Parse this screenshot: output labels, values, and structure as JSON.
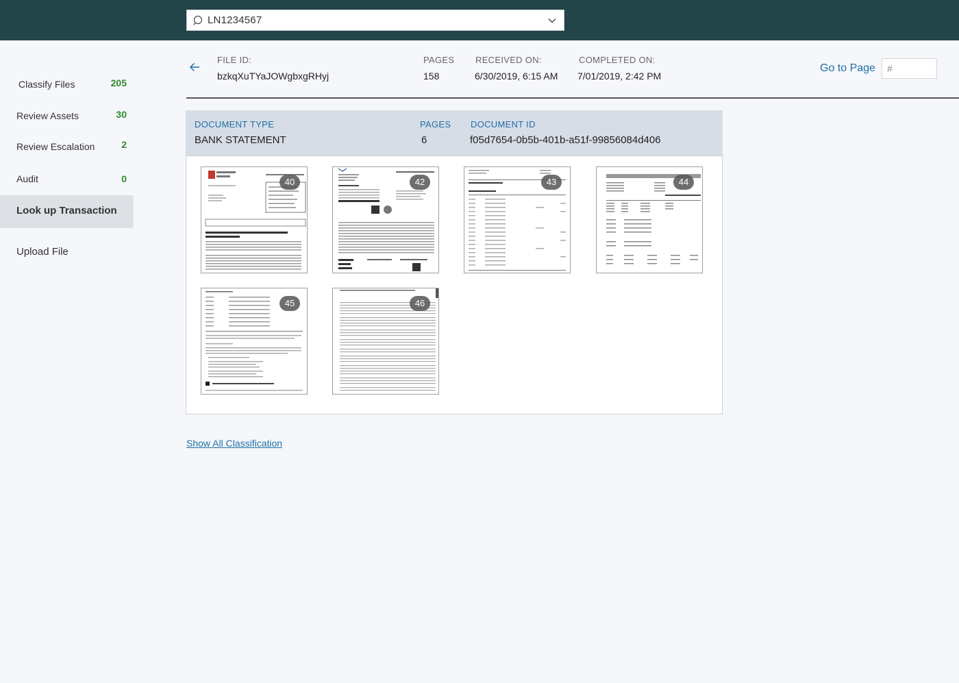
{
  "search": {
    "value": "LN1234567"
  },
  "sidebar": {
    "items": [
      {
        "label": "Classify Files",
        "count": "205"
      },
      {
        "label": "Review Assets",
        "count": "30"
      },
      {
        "label": "Review Escalation",
        "count": "2"
      },
      {
        "label": "Audit",
        "count": "0"
      },
      {
        "label": "Look up Transaction",
        "active": true
      },
      {
        "label": "Upload File"
      }
    ]
  },
  "file_header": {
    "file_id_label": "FILE ID:",
    "file_id": "bzkqXuTYaJOWgbxgRHyj",
    "pages_label": "PAGES",
    "pages": "158",
    "received_label": "RECEIVED ON:",
    "received": "6/30/2019, 6:15 AM",
    "completed_label": "COMPLETED ON:",
    "completed": "7/01/2019, 2:42 PM",
    "goto_label": "Go to Page",
    "goto_placeholder": "#"
  },
  "document": {
    "type_label": "DOCUMENT TYPE",
    "type": "BANK STATEMENT",
    "pages_label": "PAGES",
    "pages": "6",
    "id_label": "DOCUMENT ID",
    "id": "f05d7654-0b5b-401b-a51f-99856084d406",
    "thumbnails": [
      {
        "page": "40"
      },
      {
        "page": "42"
      },
      {
        "page": "43"
      },
      {
        "page": "44"
      },
      {
        "page": "45"
      },
      {
        "page": "46"
      }
    ]
  },
  "links": {
    "show_all": "Show All Classification"
  },
  "colors": {
    "topbar": "#234449",
    "accent": "#1f6fa6",
    "count": "#2e8b2e"
  }
}
